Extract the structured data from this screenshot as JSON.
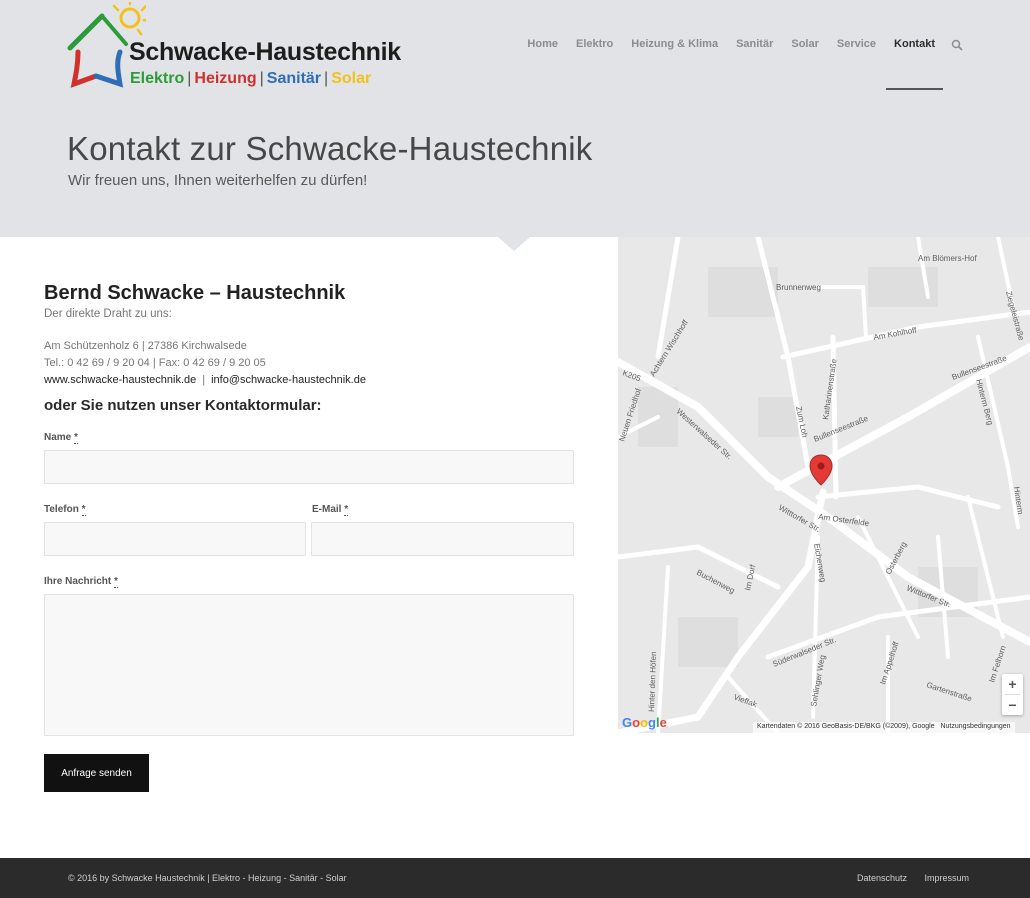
{
  "logo": {
    "name": "Schwacke-Haustechnik",
    "tags": [
      {
        "label": "Elektro",
        "color": "#2e9b3a"
      },
      {
        "label": "Heizung",
        "color": "#d0312d"
      },
      {
        "label": "Sanitär",
        "color": "#2f6db5"
      },
      {
        "label": "Solar",
        "color": "#f2c21b"
      }
    ],
    "separator": "|"
  },
  "nav": {
    "items": [
      {
        "label": "Home"
      },
      {
        "label": "Elektro"
      },
      {
        "label": "Heizung & Klima"
      },
      {
        "label": "Sanitär"
      },
      {
        "label": "Solar"
      },
      {
        "label": "Service"
      },
      {
        "label": "Kontakt",
        "active": true
      }
    ],
    "search_icon": "search-icon"
  },
  "hero": {
    "title": "Kontakt zur Schwacke-Haustechnik",
    "subtitle": "Wir freuen uns, Ihnen weiterhelfen zu dürfen!"
  },
  "contact": {
    "company": "Bernd Schwacke – Haustechnik",
    "direct": "Der direkte Draht zu uns:",
    "address": "Am Schützenholz 6 | 27386 Kirchwalsede",
    "phone": "Tel.: 0 42 69 / 9 20 04  |  Fax: 0 42 69 / 9 20 05",
    "website": "www.schwacke-haustechnik.de",
    "link_separator": "|",
    "email": "info@schwacke-haustechnik.de",
    "form_heading": "oder Sie nutzen unser Kontaktormular:"
  },
  "form": {
    "name_label": "Name",
    "phone_label": "Telefon",
    "email_label": "E-Mail",
    "message_label": "Ihre Nachricht",
    "required_mark": "*",
    "submit_label": "Anfrage senden"
  },
  "map": {
    "labels": [
      "Am Blömers-Hof",
      "Brunnenweg",
      "Am Kohlhoff",
      "Ziegeleistraße",
      "Bullenseestraße",
      "K205",
      "Achtern Wischhoff",
      "Katharinenstraße",
      "Hinterm Berg",
      "Neuen Friedhof",
      "Westerwalseder Str.",
      "Zum Loh",
      "Bullenseestraße",
      "Am Osterfelde",
      "Witttorfer Str.",
      "Im Dorf",
      "Eichenweg",
      "Osterberg",
      "Buchenweg",
      "Witttorfer Str.",
      "Hinterm",
      "Süderwalseder Str.",
      "Im Appelhoff",
      "Im Felhorn",
      "Hinter den Höfen",
      "Sehlinger Weg",
      "Gartenstraße",
      "Vieffak"
    ],
    "zoom_in": "+",
    "zoom_out": "−",
    "google": [
      {
        "char": "G",
        "color": "#4285f4"
      },
      {
        "char": "o",
        "color": "#ea4335"
      },
      {
        "char": "o",
        "color": "#fbbc05"
      },
      {
        "char": "g",
        "color": "#4285f4"
      },
      {
        "char": "l",
        "color": "#34a853"
      },
      {
        "char": "e",
        "color": "#ea4335"
      }
    ],
    "attribution": "Kartendaten © 2016 GeoBasis-DE/BKG (©2009), Google",
    "terms": "Nutzungsbedingungen",
    "marker_color": "#e53935",
    "marker_icon": "map-pin-icon"
  },
  "footer": {
    "copyright": "© 2016 by Schwacke Haustechnik | Elektro - Heizung - Sanitär - Solar",
    "links": [
      "Datenschutz",
      "Impressum"
    ]
  }
}
